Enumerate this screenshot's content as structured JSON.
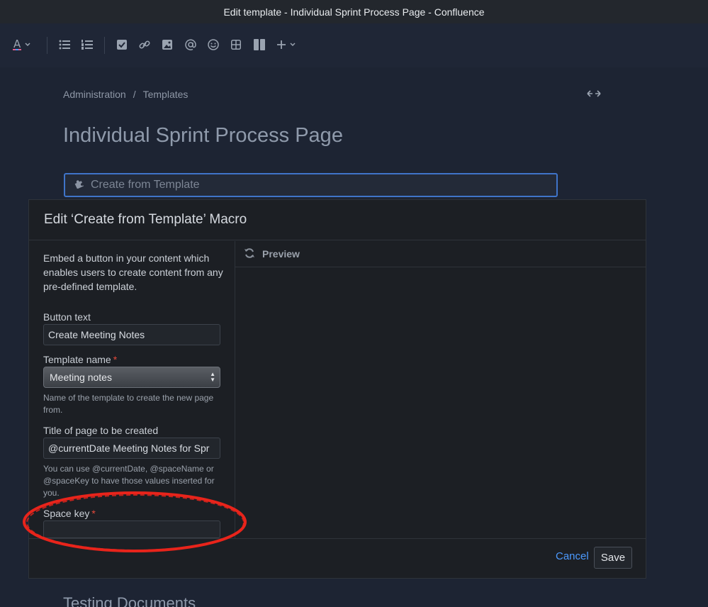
{
  "window": {
    "title": "Edit template - Individual Sprint Process Page - Confluence"
  },
  "toolbar": {
    "icons": [
      "text-color-icon",
      "bullet-list-icon",
      "numbered-list-icon",
      "task-icon",
      "link-icon",
      "image-icon",
      "mention-icon",
      "emoji-icon",
      "table-icon",
      "layout-icon",
      "insert-more-icon"
    ]
  },
  "breadcrumb": {
    "items": [
      "Administration",
      "Templates"
    ],
    "separator": "/"
  },
  "page": {
    "title": "Individual Sprint Process Page",
    "macro_placeholder": "Create from Template",
    "next_heading": "Testing Documents"
  },
  "dialog": {
    "title": "Edit ‘Create from Template’ Macro",
    "intro": "Embed a button in your content which enables users to create content from any pre-defined template.",
    "button_text": {
      "label": "Button text",
      "value": "Create Meeting Notes"
    },
    "template_name": {
      "label": "Template name",
      "required_mark": "*",
      "value": "Meeting notes",
      "help": "Name of the template to create the new page from."
    },
    "page_title": {
      "label": "Title of page to be created",
      "value": "@currentDate Meeting Notes for Spr",
      "help": "You can use @currentDate, @spaceName or @spaceKey to have those values inserted for you."
    },
    "space_key": {
      "label": "Space key",
      "required_mark": "*",
      "value": ""
    },
    "preview_label": "Preview",
    "cancel_label": "Cancel",
    "save_label": "Save"
  },
  "colors": {
    "accent": "#4c9aff",
    "required": "#e5493a",
    "annotation": "#e8241b",
    "focus_border": "#3f74c9"
  }
}
